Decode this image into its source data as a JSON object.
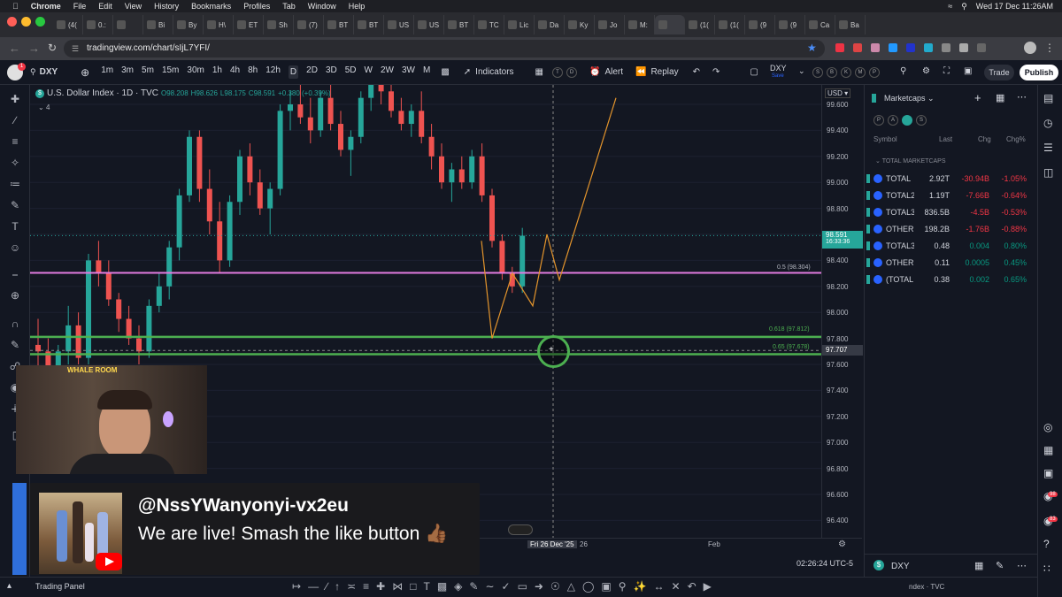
{
  "macbar": {
    "app": "Chrome",
    "menus": [
      "File",
      "Edit",
      "View",
      "History",
      "Bookmarks",
      "Profiles",
      "Tab",
      "Window",
      "Help"
    ],
    "datetime": "Wed 17 Dec  11:26AM"
  },
  "tabs": [
    "(4(",
    "0.:",
    "",
    "Bi",
    "By",
    "H\\",
    "ET",
    "Sh",
    "(7)",
    "BT",
    "BT",
    "US",
    "US",
    "BT",
    "TC",
    "Lic",
    "Da",
    "Ky",
    "Jo",
    "M:",
    "",
    "(1(",
    "(1(",
    "(9",
    "(9",
    "Ca",
    "Ba"
  ],
  "address": {
    "url": "tradingview.com/chart/sIjL7YFI/"
  },
  "tv_header": {
    "symbol": "DXY",
    "timeframes": [
      "1m",
      "3m",
      "5m",
      "15m",
      "30m",
      "1h",
      "4h",
      "8h",
      "12h",
      "D",
      "2D",
      "3D",
      "5D",
      "W",
      "2W",
      "3W",
      "M"
    ],
    "active_timeframe": "D",
    "indicators_label": "Indicators",
    "alert_label": "Alert",
    "replay_label": "Replay",
    "layout_symbol": "DXY",
    "layout_sub": "Save",
    "trade_label": "Trade",
    "publish_label": "Publish"
  },
  "legend": {
    "title": "U.S. Dollar Index · 1D · TVC",
    "o": "O98.208",
    "h": "H98.626",
    "l": "L98.175",
    "c": "C98.591",
    "change": "+0.380 (+0.39%)",
    "collapse": "4"
  },
  "chart": {
    "currency": "USD",
    "price_ticks": [
      "99.600",
      "99.400",
      "99.200",
      "99.000",
      "98.800",
      "98.600",
      "98.400",
      "98.200",
      "98.000",
      "97.800",
      "97.600",
      "97.400",
      "97.200",
      "97.000",
      "96.800",
      "96.600",
      "96.400"
    ],
    "current_price": "98.591",
    "countdown": "16:33:36",
    "crosshair_price": "97.707",
    "fib_labels": [
      "0.5 (98.304)",
      "0.618 (97.812)",
      "0.65 (97.678)"
    ],
    "time_labels": [
      "26",
      "Feb"
    ],
    "crosshair_date": "Fri 26 Dec '25",
    "clock": "02:26:24 UTC-5"
  },
  "watchlist": {
    "title": "Marketcaps",
    "columns": [
      "Symbol",
      "Last",
      "Chg",
      "Chg%"
    ],
    "section": "TOTAL MARKETCAPS",
    "rows": [
      {
        "symbol": "TOTAL",
        "last": "2.92T",
        "chg": "-30.94B",
        "pct": "-1.05%",
        "dir": "neg"
      },
      {
        "symbol": "TOTAL2",
        "last": "1.19T",
        "chg": "-7.66B",
        "pct": "-0.64%",
        "dir": "neg"
      },
      {
        "symbol": "TOTAL3",
        "last": "836.5B",
        "chg": "-4.5B",
        "pct": "-0.53%",
        "dir": "neg"
      },
      {
        "symbol": "OTHERS",
        "last": "198.2B",
        "chg": "-1.76B",
        "pct": "-0.88%",
        "dir": "neg"
      },
      {
        "symbol": "TOTAL3",
        "last": "0.48",
        "chg": "0.004",
        "pct": "0.80%",
        "dir": "pos"
      },
      {
        "symbol": "OTHERS",
        "last": "0.11",
        "chg": "0.0005",
        "pct": "0.45%",
        "dir": "pos"
      },
      {
        "symbol": "(TOTAL",
        "last": "0.38",
        "chg": "0.002",
        "pct": "0.65%",
        "dir": "pos"
      }
    ],
    "bottom_symbol": "DXY",
    "bottom_sub": "ndex · TVC"
  },
  "right_badges": [
    "98",
    "83"
  ],
  "bottom": {
    "trading_panel": "Trading Panel"
  },
  "stream": {
    "username": "@NssYWanyonyi-vx2eu",
    "message": "We are live! Smash the like button 👍🏾",
    "logo_text": "WHALE ROOM"
  },
  "colors": {
    "up": "#26a69a",
    "down": "#ef5350",
    "fib_purple": "#e07be0",
    "fib_green": "#4caf50",
    "projection": "#e3942c"
  }
}
